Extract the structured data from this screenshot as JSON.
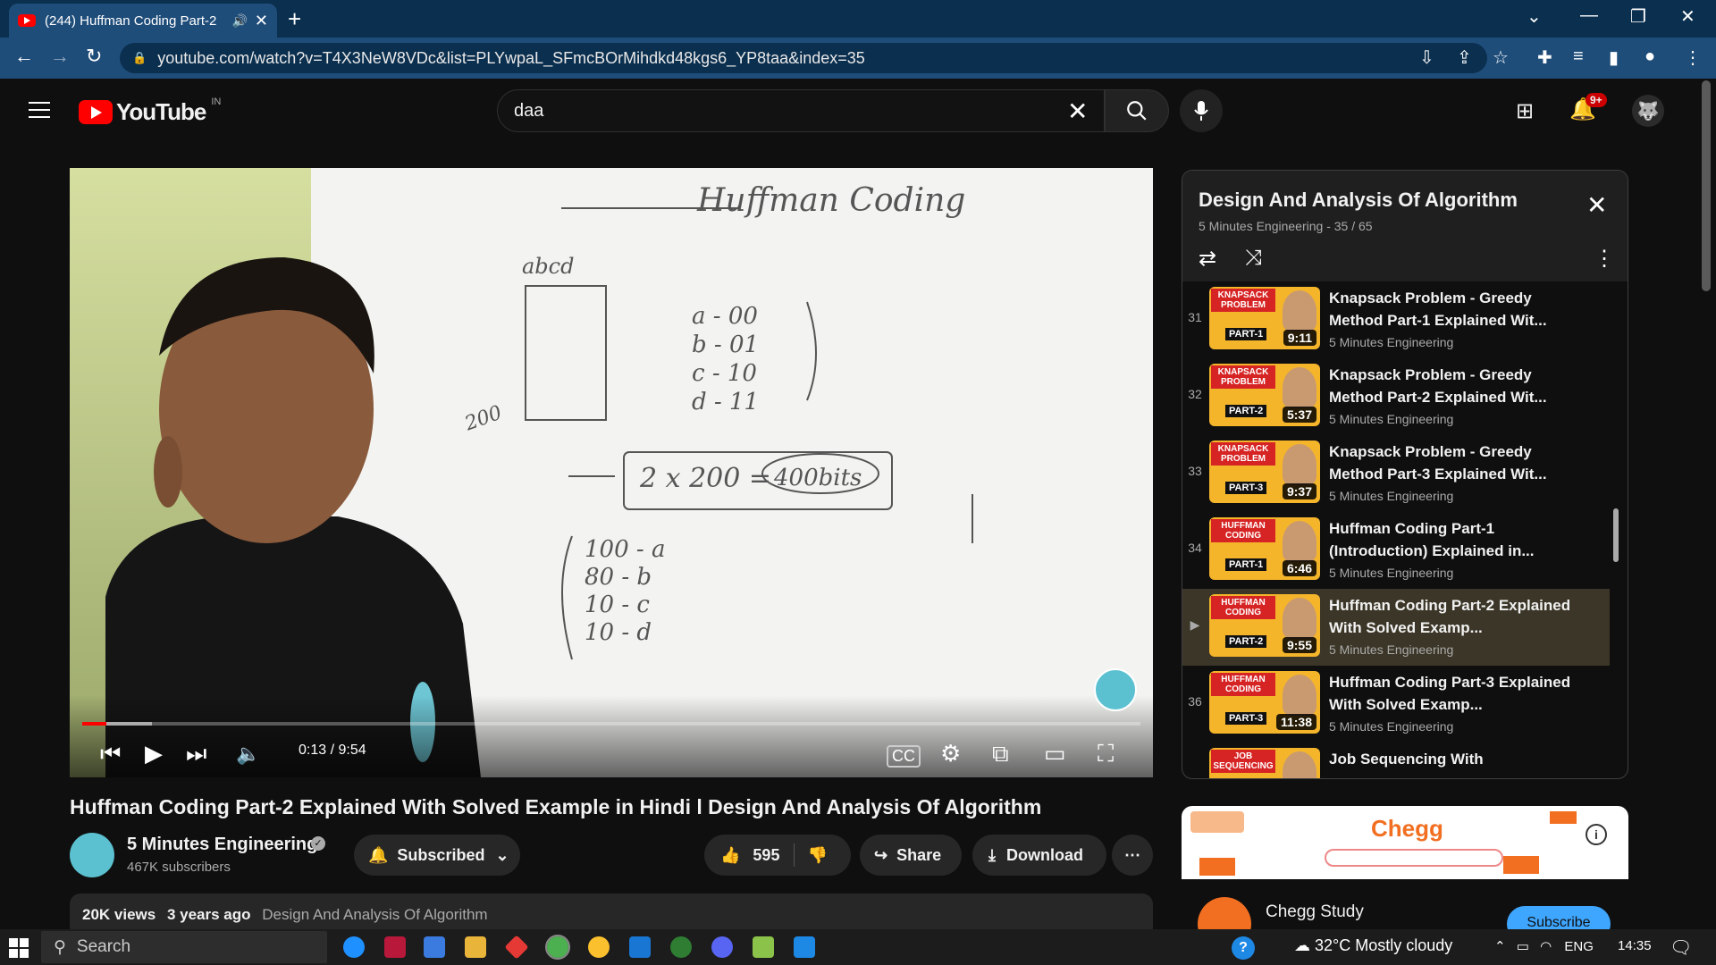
{
  "browser": {
    "tab_title": "(244) Huffman Coding Part-2",
    "url": "youtube.com/watch?v=T4X3NeW8VDc&list=PLYwpaL_SFmcBOrMihdkd48kgs6_YP8taa&index=35"
  },
  "youtube": {
    "logo_text": "YouTube",
    "country": "IN",
    "search_value": "daa",
    "notification_count": "9+"
  },
  "player": {
    "time": "0:13 / 9:54",
    "progress_fraction": 0.023,
    "buffered_fraction": 0.066,
    "board": {
      "heading": "Huffman Coding",
      "box_label": "abcd",
      "side_label": "200",
      "codes": [
        "a - 00",
        "b - 01",
        "c - 10",
        "d - 11"
      ],
      "calc": "2 x 200 =",
      "result": "400bits",
      "freqs": [
        "100 - a",
        "80 - b",
        "10 - c",
        "10 - d"
      ]
    }
  },
  "video": {
    "title": "Huffman Coding Part-2 Explained With Solved Example in Hindi l Design And Analysis Of Algorithm",
    "channel": "5 Minutes Engineering",
    "subscribers": "467K subscribers",
    "subscribed_label": "Subscribed",
    "likes": "595",
    "share_label": "Share",
    "download_label": "Download",
    "views": "20K views",
    "age": "3 years ago",
    "playlist_link": "Design And Analysis Of Algorithm"
  },
  "playlist": {
    "title": "Design And Analysis Of Algorithm",
    "subtitle": "5 Minutes Engineering - 35 / 65",
    "items": [
      {
        "index": "31",
        "title": "Knapsack Problem - Greedy Method Part-1 Explained Wit...",
        "channel": "5 Minutes Engineering",
        "duration": "9:11",
        "thumb_top": "KNAPSACK PROBLEM",
        "thumb_part": "PART-1",
        "active": false
      },
      {
        "index": "32",
        "title": "Knapsack Problem - Greedy Method Part-2 Explained Wit...",
        "channel": "5 Minutes Engineering",
        "duration": "5:37",
        "thumb_top": "KNAPSACK PROBLEM",
        "thumb_part": "PART-2",
        "active": false
      },
      {
        "index": "33",
        "title": "Knapsack Problem - Greedy Method Part-3 Explained Wit...",
        "channel": "5 Minutes Engineering",
        "duration": "9:37",
        "thumb_top": "KNAPSACK PROBLEM",
        "thumb_part": "PART-3",
        "active": false
      },
      {
        "index": "34",
        "title": "Huffman Coding Part-1 (Introduction) Explained in...",
        "channel": "5 Minutes Engineering",
        "duration": "6:46",
        "thumb_top": "HUFFMAN CODING",
        "thumb_part": "PART-1",
        "active": false
      },
      {
        "index": "▶",
        "title": "Huffman Coding Part-2 Explained With Solved Examp...",
        "channel": "5 Minutes Engineering",
        "duration": "9:55",
        "thumb_top": "HUFFMAN CODING",
        "thumb_part": "PART-2",
        "active": true
      },
      {
        "index": "36",
        "title": "Huffman Coding Part-3 Explained With Solved Examp...",
        "channel": "5 Minutes Engineering",
        "duration": "11:38",
        "thumb_top": "HUFFMAN CODING",
        "thumb_part": "PART-3",
        "active": false
      },
      {
        "index": "",
        "title": "Job Sequencing With",
        "channel": "",
        "duration": "",
        "thumb_top": "JOB SEQUENCING",
        "thumb_part": "",
        "active": false
      }
    ]
  },
  "ad": {
    "brand": "Chegg",
    "advertiser": "Chegg Study",
    "cta": "Subscribe"
  },
  "taskbar": {
    "search_placeholder": "Search",
    "weather": "32°C  Mostly cloudy",
    "language": "ENG",
    "time": "14:35"
  },
  "colors": {
    "accent_red": "#ff0000",
    "chrome_blue": "#1f4d7a",
    "active_item": "#3b3627"
  }
}
